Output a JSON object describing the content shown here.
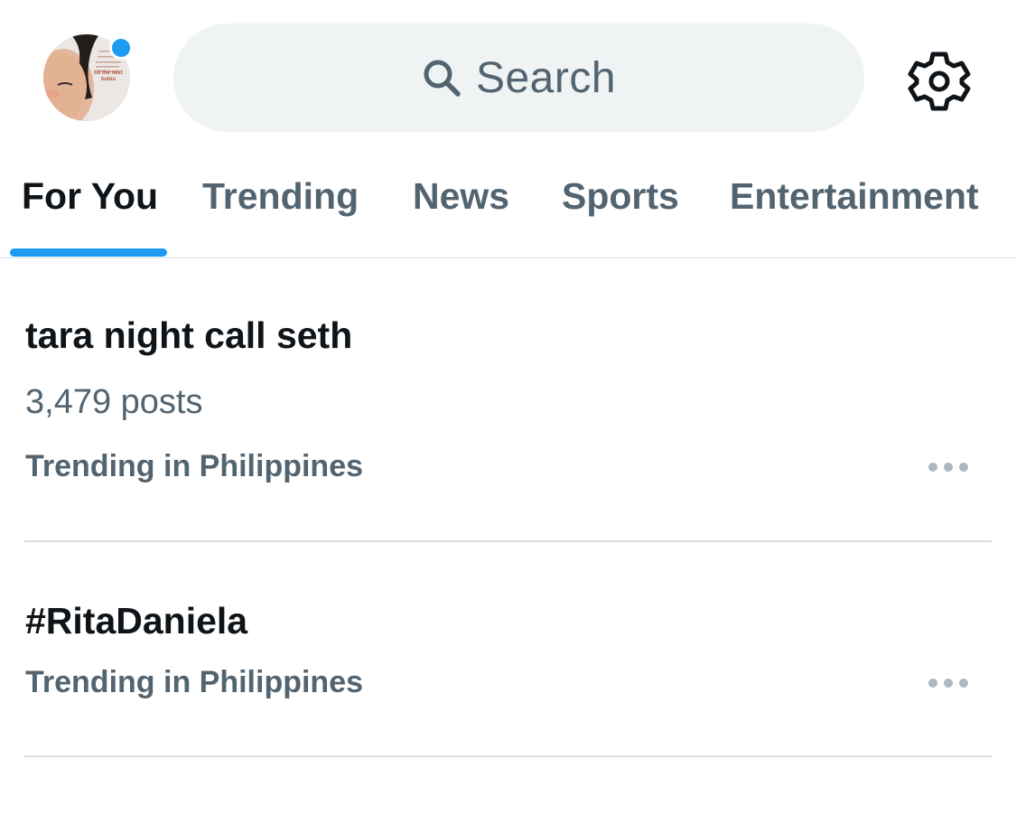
{
  "header": {
    "avatar_lines": [
      "till the next",
      "kumu"
    ],
    "search_placeholder": "Search",
    "status_dot_color": "#1d9bf0",
    "icons": [
      "avatar",
      "search-icon",
      "gear-icon"
    ]
  },
  "tabs": [
    {
      "label": "For You",
      "active": true
    },
    {
      "label": "Trending",
      "active": false
    },
    {
      "label": "News",
      "active": false
    },
    {
      "label": "Sports",
      "active": false
    },
    {
      "label": "Entertainment",
      "active": false
    }
  ],
  "trends": [
    {
      "title": "tara night call seth",
      "posts": "3,479 posts",
      "context": "Trending in Philippines"
    },
    {
      "title": "#RitaDaniela",
      "context": "Trending in Philippines"
    }
  ],
  "colors": {
    "accent": "#1d9bf0",
    "primary_text": "#0f1419",
    "secondary_text": "#536471",
    "search_bg": "#eff3f4"
  }
}
